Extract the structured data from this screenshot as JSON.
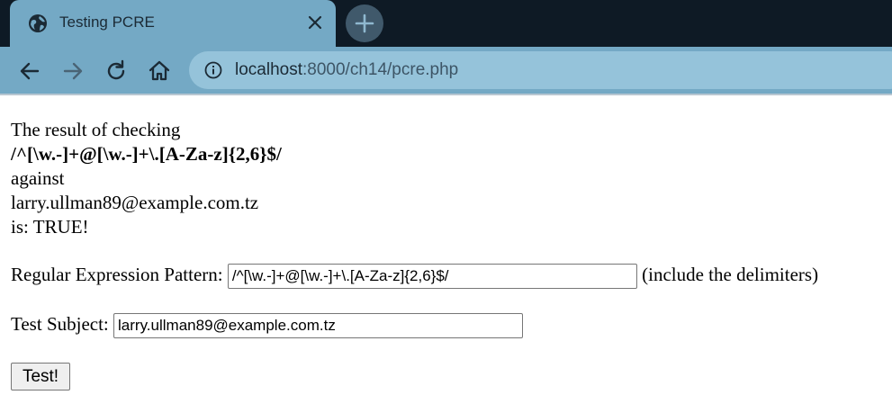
{
  "browser": {
    "tab_title": "Testing PCRE",
    "url_host": "localhost",
    "url_path": ":8000/ch14/pcre.php"
  },
  "result": {
    "line1": "The result of checking",
    "pattern": "/^[\\w.-]+@[\\w.-]+\\.[A-Za-z]{2,6}$/",
    "line3": "against",
    "subject": "larry.ullman89@example.com.tz",
    "outcome": "is: TRUE!"
  },
  "form": {
    "pattern_label": "Regular Expression Pattern:",
    "pattern_value": "/^[\\w.-]+@[\\w.-]+\\.[A-Za-z]{2,6}$/",
    "pattern_hint": "(include the delimiters)",
    "subject_label": "Test Subject:",
    "subject_value": "larry.ullman89@example.com.tz",
    "submit_label": "Test!"
  },
  "colors": {
    "tabstrip": "#0e1a25",
    "toolbar": "#74a9c5",
    "omnibox": "#95c3da"
  },
  "icons": [
    "globe-icon",
    "close-icon",
    "plus-icon",
    "back-icon",
    "forward-icon",
    "reload-icon",
    "home-icon",
    "info-icon"
  ]
}
